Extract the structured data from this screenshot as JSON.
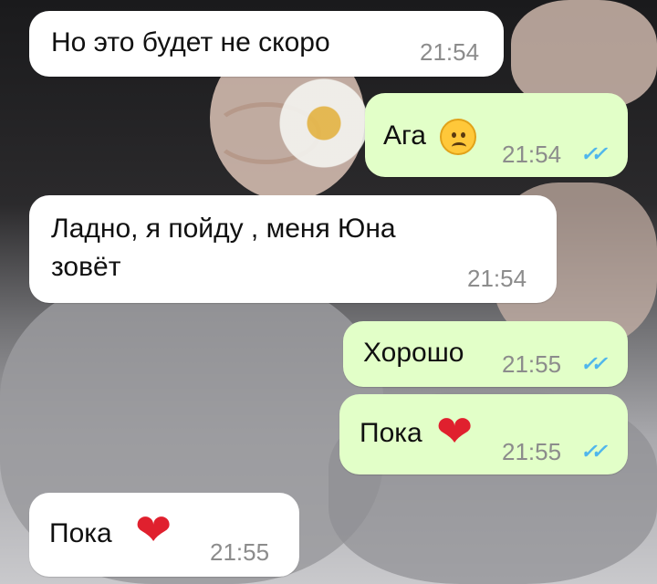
{
  "chat": {
    "messages": [
      {
        "direction": "incoming",
        "text": "Но это будет не скоро",
        "time": "21:54"
      },
      {
        "direction": "outgoing",
        "text": "Ага",
        "emoji": "sad-face-emoji",
        "time": "21:54",
        "status": "read-double-check"
      },
      {
        "direction": "incoming",
        "text_line1": "Ладно, я пойду , меня Юна",
        "text_line2": "зовёт",
        "time": "21:54"
      },
      {
        "direction": "outgoing",
        "text": "Хорошо",
        "time": "21:55",
        "status": "read-double-check"
      },
      {
        "direction": "outgoing",
        "text": "Пока",
        "emoji": "red-heart-emoji",
        "time": "21:55",
        "status": "read-double-check"
      },
      {
        "direction": "incoming",
        "text": "Пока",
        "emoji": "red-heart-emoji",
        "time": "21:55"
      }
    ]
  },
  "colors": {
    "incoming_bubble": "#ffffff",
    "outgoing_bubble": "#e2ffc8",
    "read_ticks": "#4fb6ec",
    "timestamp": "#8c8c8c"
  }
}
